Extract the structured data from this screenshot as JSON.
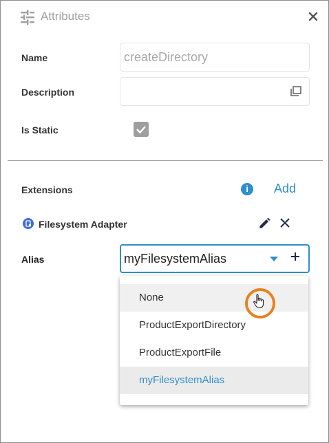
{
  "header": {
    "title": "Attributes",
    "icon": "sliders-icon",
    "close_icon": "close-icon"
  },
  "form": {
    "name_label": "Name",
    "name_value": "createDirectory",
    "description_label": "Description",
    "description_value": "",
    "is_static_label": "Is Static",
    "is_static_checked": true
  },
  "extensions": {
    "label": "Extensions",
    "info_icon": "info-icon",
    "add_label": "Add",
    "item_name": "Filesystem Adapter",
    "item_icon": "adapter-icon"
  },
  "alias": {
    "label": "Alias",
    "value": "myFilesystemAlias",
    "options": [
      "None",
      "ProductExportDirectory",
      "ProductExportFile",
      "myFilesystemAlias"
    ],
    "selected": "myFilesystemAlias",
    "hovered": "None"
  },
  "colors": {
    "accent": "#2f8fc8",
    "cursor_highlight": "#e8821e",
    "checkbox": "#9e9e9e"
  }
}
